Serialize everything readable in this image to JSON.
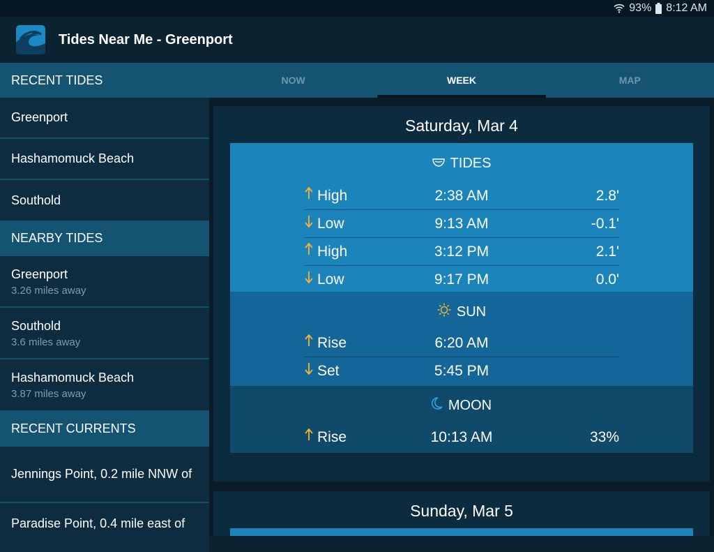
{
  "status": {
    "battery": "93%",
    "time": "8:12 AM"
  },
  "app": {
    "title": "Tides Near Me - Greenport"
  },
  "sidebar": {
    "recent_tides_header": "RECENT TIDES",
    "recent_tides": [
      "Greenport",
      "Hashamomuck Beach",
      "Southold"
    ],
    "nearby_tides_header": "NEARBY TIDES",
    "nearby_tides": [
      {
        "name": "Greenport",
        "distance": "3.26 miles away"
      },
      {
        "name": "Southold",
        "distance": "3.6 miles away"
      },
      {
        "name": "Hashamomuck Beach",
        "distance": "3.87 miles away"
      }
    ],
    "recent_currents_header": "RECENT CURRENTS",
    "recent_currents": [
      "Jennings Point, 0.2 mile NNW of",
      "Paradise Point, 0.4 mile east of"
    ]
  },
  "tabs": [
    {
      "label": "NOW",
      "active": false
    },
    {
      "label": "WEEK",
      "active": true
    },
    {
      "label": "MAP",
      "active": false
    }
  ],
  "days": [
    {
      "date": "Saturday, Mar 4",
      "tides_title": "TIDES",
      "tides": [
        {
          "direction": "up",
          "type": "High",
          "time": "2:38 AM",
          "height": "2.8'"
        },
        {
          "direction": "down",
          "type": "Low",
          "time": "9:13 AM",
          "height": "-0.1'"
        },
        {
          "direction": "up",
          "type": "High",
          "time": "3:12 PM",
          "height": "2.1'"
        },
        {
          "direction": "down",
          "type": "Low",
          "time": "9:17 PM",
          "height": "0.0'"
        }
      ],
      "sun_title": "SUN",
      "sun": [
        {
          "direction": "up",
          "type": "Rise",
          "time": "6:20 AM"
        },
        {
          "direction": "down",
          "type": "Set",
          "time": "5:45 PM"
        }
      ],
      "moon_title": "MOON",
      "moon": [
        {
          "direction": "up",
          "type": "Rise",
          "time": "10:13 AM",
          "illumination": "33%"
        }
      ]
    },
    {
      "date": "Sunday, Mar 5"
    }
  ],
  "colors": {
    "accent_arrow": "#f2b632",
    "tides_panel": "#1a84bb",
    "sun_panel": "#156698",
    "moon_panel": "#0f4a6b",
    "sidebar_header": "#155373"
  },
  "icons": {
    "wifi": "wifi-icon",
    "battery": "battery-icon",
    "app": "wave-logo-icon",
    "tides": "bowl-icon",
    "sun": "sun-icon",
    "moon": "moon-icon",
    "up": "arrow-up-icon",
    "down": "arrow-down-icon"
  }
}
